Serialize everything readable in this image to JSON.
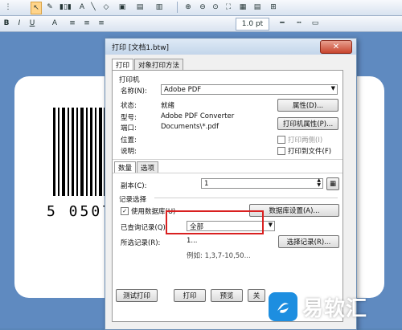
{
  "toolbar1": {
    "icons": [
      "select-arrow",
      "pen",
      "text-A",
      "line",
      "shape",
      "barcode",
      "image",
      "zoom-in",
      "zoom-out",
      "zoom-fit",
      "grid",
      "table"
    ]
  },
  "toolbar2": {
    "bold": "B",
    "italic": "I",
    "underline": "U",
    "font_color": "A",
    "line_width": "1.0 pt"
  },
  "dialog": {
    "title": "打印 [文档1.btw]",
    "close": "✕",
    "tabs": [
      "打印",
      "对象打印方法"
    ],
    "printer_group": "打印机",
    "name_label": "名称(N):",
    "name_value": "Adobe PDF",
    "status_label": "状态:",
    "status_value": "就绪",
    "type_label": "型号:",
    "type_value": "Adobe PDF Converter",
    "port_label": "端口:",
    "port_value": "Documents\\*.pdf",
    "location_label": "位置:",
    "comment_label": "说明:",
    "properties_button": "属性(D)...",
    "printer_properties_button": "打印机属性(P)...",
    "print_sample": "打印两侧(I)",
    "print_to_file": "打印到文件(F)",
    "subtabs": [
      "数量",
      "选项"
    ],
    "copies_label": "副本(C):",
    "copies_value": "1",
    "records_group": "记录选择",
    "use_db_label": "使用数据库(U)",
    "db_setup_button": "数据库设置(A)...",
    "queried_label": "已查询记录(Q):",
    "queried_value": "全部",
    "selected_label": "所选记录(R):",
    "selected_value": "1...",
    "select_records_button": "选择记录(R)...",
    "example": "例如: 1,3,7-10,50...",
    "test_print_button": "测试打印",
    "print_button": "打印",
    "preview_button": "预览",
    "close_button": "关"
  },
  "barcode_text": "5 0507",
  "watermark": {
    "text": "易软汇"
  },
  "colors": {
    "highlight": "#d92020",
    "background": "#5f8ac0",
    "logo": "#1d8ee0"
  }
}
